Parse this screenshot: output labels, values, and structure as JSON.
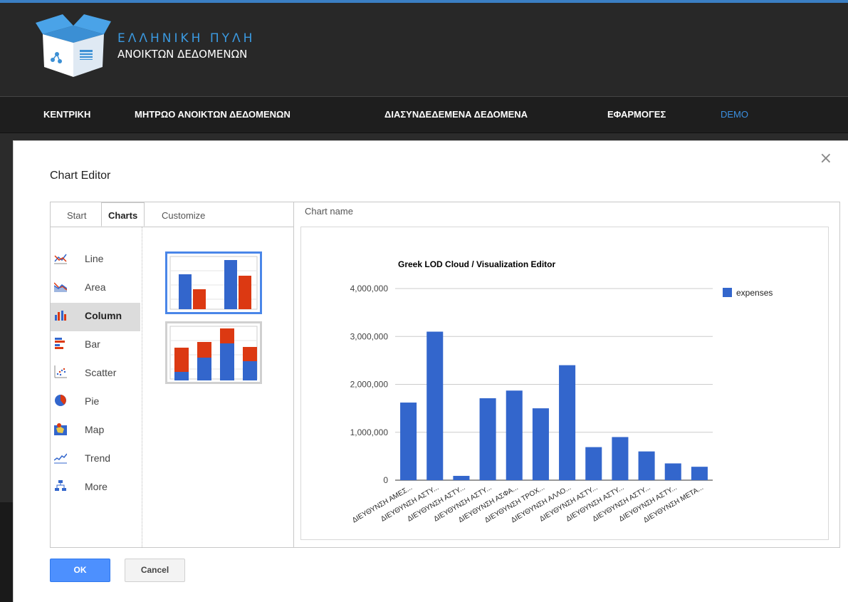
{
  "header": {
    "logo_line1": "ΕΛΛΗΝΙΚΗ ΠΥΛΗ",
    "logo_line2": "ΑΝΟΙΚΤΩΝ ΔΕΔΟΜΕΝΩΝ"
  },
  "nav": {
    "items": [
      {
        "label": "ΚΕΝΤΡΙΚΗ"
      },
      {
        "label": "ΜΗΤΡΩΟ ΑΝΟΙΚΤΩΝ ΔΕΔΟΜΕΝΩΝ"
      },
      {
        "label": "ΔΙΑΣΥΝΔΕΔΕΜΕΝΑ ΔΕΔΟΜΕΝΑ"
      },
      {
        "label": "ΕΦΑΡΜΟΓΕΣ"
      },
      {
        "label": "DEMO"
      }
    ],
    "active_color": "#3b8fe0"
  },
  "dialog": {
    "title": "Chart Editor",
    "close": "×",
    "tabs": [
      "Start",
      "Charts",
      "Customize"
    ],
    "active_tab": "Charts",
    "chart_types": [
      {
        "label": "Line",
        "icon": "line-chart-icon"
      },
      {
        "label": "Area",
        "icon": "area-chart-icon"
      },
      {
        "label": "Column",
        "icon": "column-chart-icon"
      },
      {
        "label": "Bar",
        "icon": "bar-chart-icon"
      },
      {
        "label": "Scatter",
        "icon": "scatter-chart-icon"
      },
      {
        "label": "Pie",
        "icon": "pie-chart-icon"
      },
      {
        "label": "Map",
        "icon": "map-chart-icon"
      },
      {
        "label": "Trend",
        "icon": "trend-chart-icon"
      },
      {
        "label": "More",
        "icon": "more-charts-icon"
      }
    ],
    "selected_type": "Column",
    "chart_name_label": "Chart name",
    "ok_label": "OK",
    "cancel_label": "Cancel"
  },
  "colors": {
    "series": "#3366cc",
    "stack_top": "#dc3912",
    "accent": "#4d90fe"
  },
  "chart_data": {
    "type": "bar",
    "title": "Greek LOD Cloud / Visualization Editor",
    "categories": [
      "ΔΙΕΥΘΥΝΣΗ ΑΜΕΣ...",
      "ΔΙΕΥΘΥΝΣΗ ΑΣΤΥ...",
      "ΔΙΕΥΘΥΝΣΗ ΑΣΤΥ...",
      "ΔΙΕΥΘΥΝΣΗ ΑΣΤΥ...",
      "ΔΙΕΥΘΥΝΣΗ ΑΣΦΑ...",
      "ΔΙΕΥΘΥΝΣΗ ΤΡΟΧ...",
      "ΔΙΕΥΘΥΝΣΗ ΑΛΛΟ...",
      "ΔΙΕΥΘΥΝΣΗ ΑΣΤΥ...",
      "ΔΙΕΥΘΥΝΣΗ ΑΣΤΥ...",
      "ΔΙΕΥΘΥΝΣΗ ΑΣΤΥ...",
      "ΔΙΕΥΘΥΝΣΗ ΑΣΤΥ...",
      "ΔΙΕΥΘΥΝΣΗ ΜΕΤΑ..."
    ],
    "series": [
      {
        "name": "expenses",
        "values": [
          1620000,
          3100000,
          90000,
          1710000,
          1870000,
          1500000,
          2400000,
          690000,
          900000,
          600000,
          350000,
          280000
        ]
      }
    ],
    "ylim": [
      0,
      4000000
    ],
    "yticks": [
      "0",
      "1,000,000",
      "2,000,000",
      "3,000,000",
      "4,000,000"
    ],
    "grid": true,
    "legend": "right"
  }
}
